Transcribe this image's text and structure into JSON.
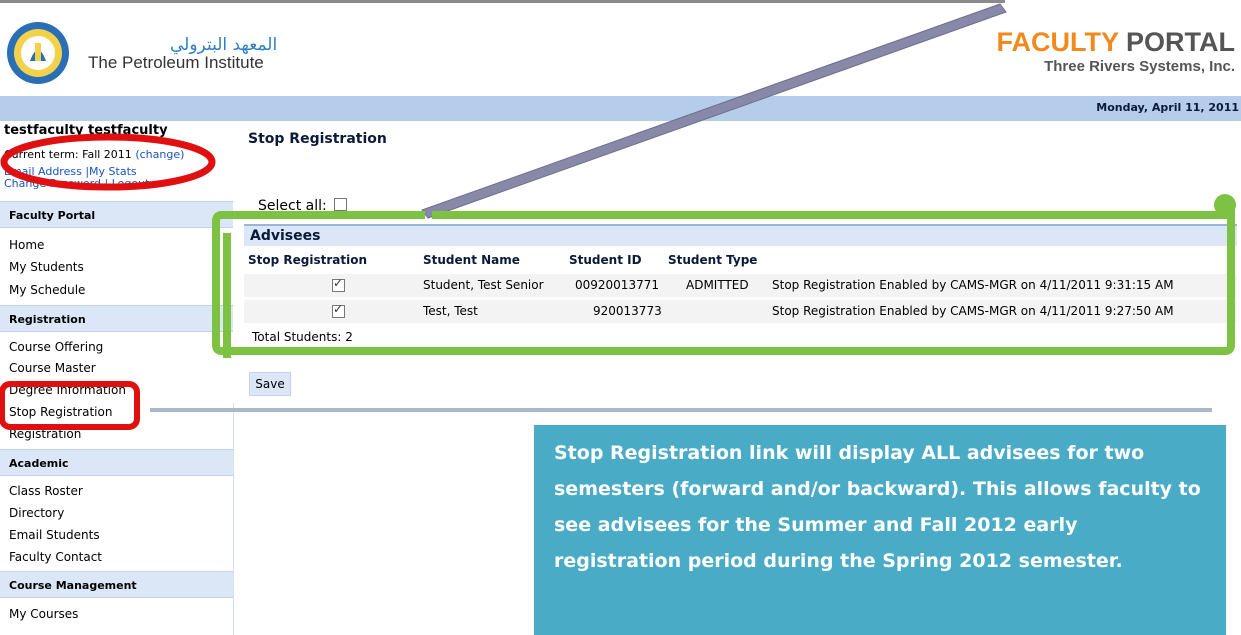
{
  "header": {
    "institute_arabic": "المعهد البترولي",
    "institute_english": "The Petroleum Institute",
    "portal_title_word1": "FACULTY",
    "portal_title_word2": "PORTAL",
    "portal_subtitle": "Three Rivers Systems, Inc.",
    "date": "Monday, April 11, 2011"
  },
  "sidebar": {
    "user_name": "testfaculty testfaculty",
    "term_label": "Current term: Fall 2011",
    "term_change": "(change)",
    "link_email": "Email Address",
    "link_stats": "My Stats",
    "link_password": "Change Password",
    "link_logout": "Logout",
    "sections": [
      {
        "title": "Faculty Portal",
        "items": [
          "Home",
          "My Students",
          "My Schedule"
        ]
      },
      {
        "title": "Registration",
        "items": [
          "Course Offering",
          "Course Master",
          "Degree Information",
          "Stop Registration",
          "Registration"
        ]
      },
      {
        "title": "Academic",
        "items": [
          "Class Roster",
          "Directory",
          "Email Students",
          "Faculty Contact"
        ]
      },
      {
        "title": "Course Management",
        "items": [
          "My Courses"
        ]
      }
    ]
  },
  "main": {
    "page_title": "Stop Registration",
    "select_all_label": "Select all:",
    "advisees_title": "Advisees",
    "columns": [
      "Stop Registration",
      "Student Name",
      "Student ID",
      "Student Type"
    ],
    "rows": [
      {
        "checked": true,
        "name": "Student, Test Senior",
        "id": "00920013771",
        "type": "ADMITTED",
        "status": "Stop Registration Enabled by CAMS-MGR on 4/11/2011 9:31:15 AM"
      },
      {
        "checked": true,
        "name": "Test, Test",
        "id": "920013773",
        "type": "",
        "status": "Stop Registration Enabled by CAMS-MGR on 4/11/2011 9:27:50 AM"
      }
    ],
    "total_label": "Total Students: 2",
    "save_label": "Save"
  },
  "callout": {
    "text": "Stop Registration link will display ALL advisees for two semesters (forward and/or backward). This allows faculty to see advisees for the Summer and Fall 2012 early registration period during the Spring 2012 semester."
  },
  "colors": {
    "accent_orange": "#f08a1d",
    "header_blue": "#b5cdea",
    "section_blue": "#dbe7f6",
    "callout_teal": "#4aabc7",
    "annotation_red": "#e01010",
    "annotation_green": "#7dc242"
  }
}
